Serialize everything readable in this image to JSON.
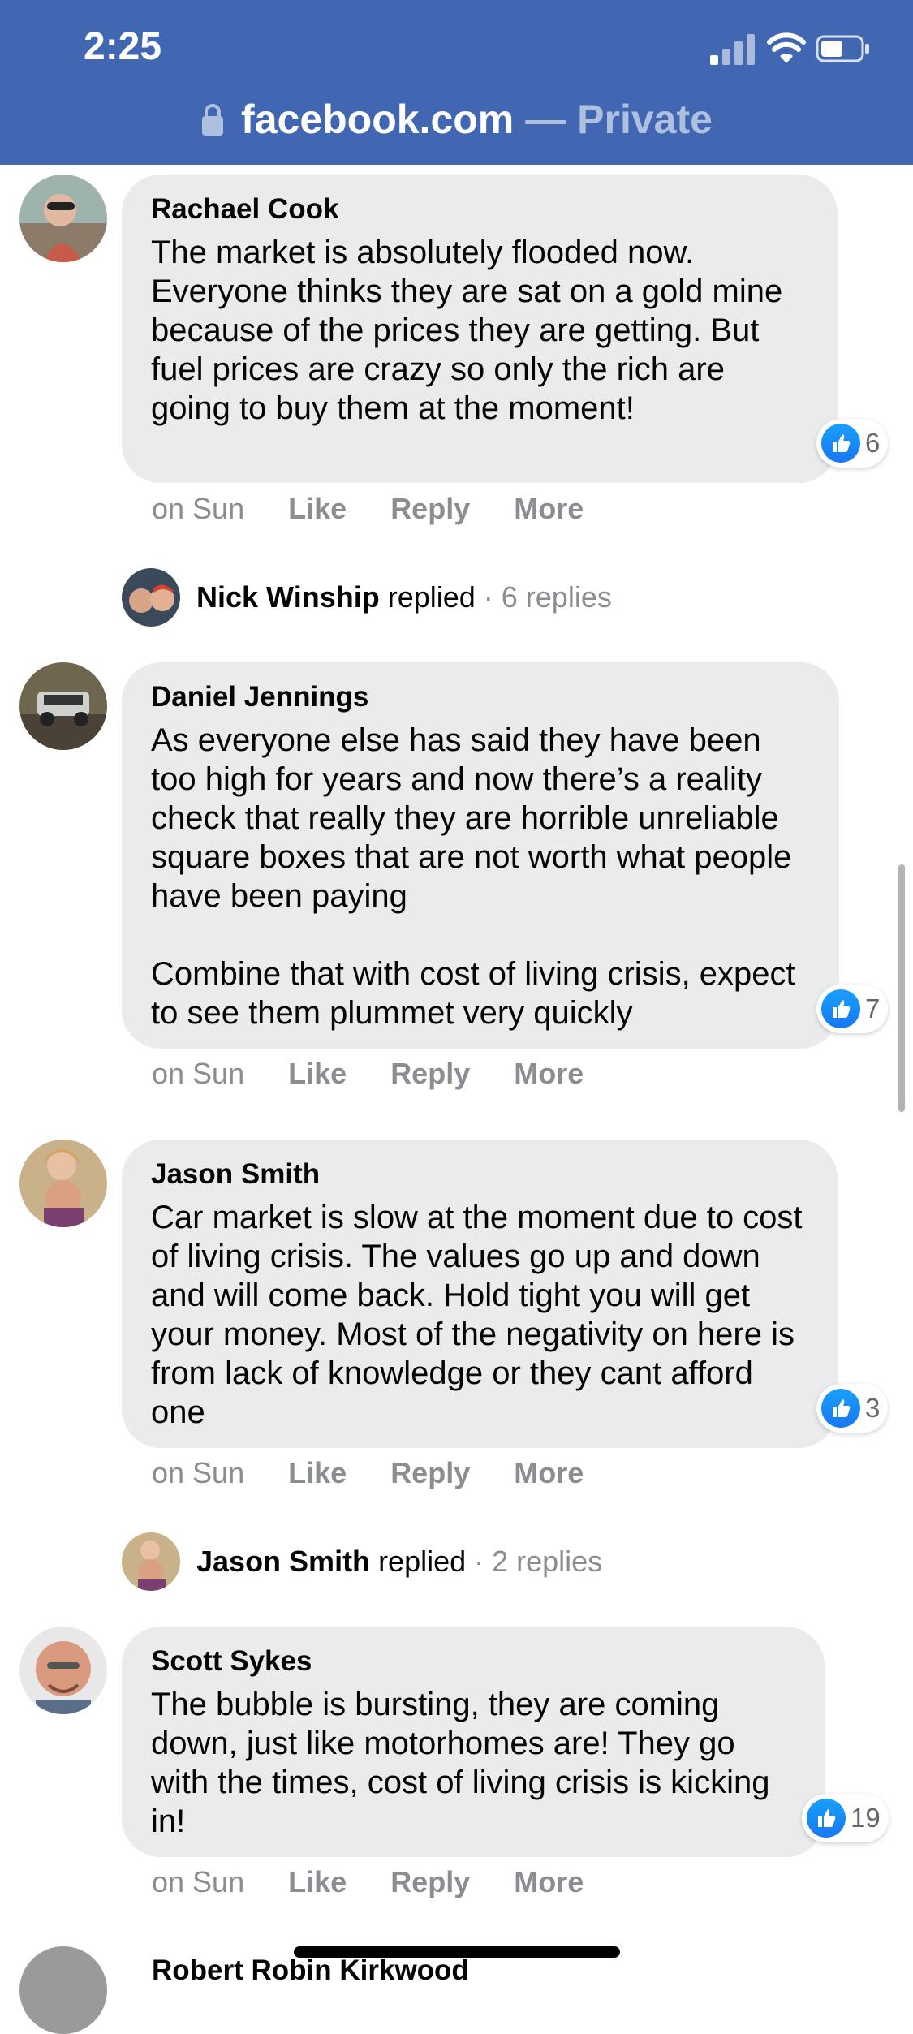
{
  "status_bar": {
    "time": "2:25"
  },
  "browser": {
    "domain": "facebook.com",
    "suffix": "— Private"
  },
  "comments": [
    {
      "author": "Rachael Cook",
      "text": "The market is absolutely flooded now. Everyone thinks they are sat on a gold mine because of the prices they are getting. But fuel prices are crazy so only the rich are going to buy them at the moment!",
      "likes": "6",
      "time": "on Sun",
      "actions": [
        "Like",
        "Reply",
        "More"
      ]
    },
    {
      "author": "Daniel Jennings",
      "text": "As everyone else has said they have been too high for years and now there’s a reality check that really they are horrible unreliable square boxes that are not worth what people have been paying\n\nCombine that with cost of living crisis, expect to see them plummet very quickly",
      "likes": "7",
      "time": "on Sun",
      "actions": [
        "Like",
        "Reply",
        "More"
      ]
    },
    {
      "author": "Jason Smith",
      "text": "Car market is slow at the moment due to cost of living crisis. The values go up and down and will come back. Hold tight you will get your money. Most of the negativity on here is from lack of knowledge or they cant afford one",
      "likes": "3",
      "time": "on Sun",
      "actions": [
        "Like",
        "Reply",
        "More"
      ]
    },
    {
      "author": "Scott Sykes",
      "text": "The bubble is bursting, they are coming down, just like motorhomes are! They go with the times, cost of living crisis is kicking in!",
      "likes": "19",
      "time": "on Sun",
      "actions": [
        "Like",
        "Reply",
        "More"
      ]
    }
  ],
  "reply_rows": [
    {
      "name": "Nick Winship",
      "verb": "replied",
      "count": "· 6 replies"
    },
    {
      "name": "Jason Smith",
      "verb": "replied",
      "count": "· 2 replies"
    }
  ],
  "partial_comment": {
    "author": "Robert Robin Kirkwood"
  },
  "colors": {
    "header": "#4267b2",
    "bubble": "#eaebed",
    "like": "#1877f2",
    "meta": "#8a8d91"
  }
}
